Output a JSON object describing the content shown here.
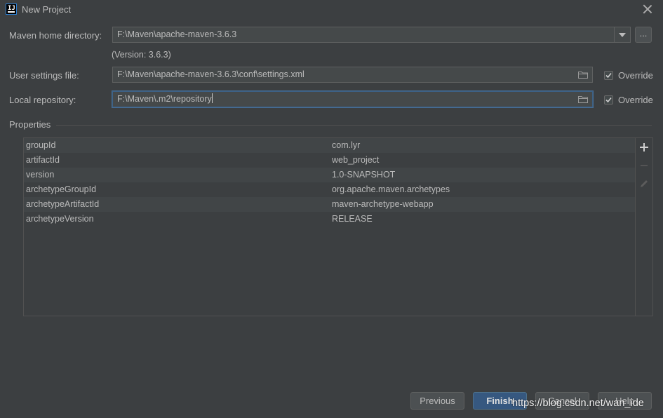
{
  "window": {
    "title": "New Project",
    "app_icon_text": "IJ"
  },
  "form": {
    "maven_home": {
      "label": "Maven home directory:",
      "value": "F:\\Maven\\apache-maven-3.6.3",
      "browse_label": "...",
      "version_text": "(Version: 3.6.3)"
    },
    "user_settings": {
      "label": "User settings file:",
      "value": "F:\\Maven\\apache-maven-3.6.3\\conf\\settings.xml",
      "override_label": "Override",
      "override_checked": true
    },
    "local_repository": {
      "label": "Local repository:",
      "value": "F:\\Maven\\.m2\\repository",
      "override_label": "Override",
      "override_checked": true
    }
  },
  "properties": {
    "title": "Properties",
    "rows": [
      {
        "key": "groupId",
        "value": "com.lyr"
      },
      {
        "key": "artifactId",
        "value": "web_project"
      },
      {
        "key": "version",
        "value": "1.0-SNAPSHOT"
      },
      {
        "key": "archetypeGroupId",
        "value": "org.apache.maven.archetypes"
      },
      {
        "key": "archetypeArtifactId",
        "value": "maven-archetype-webapp"
      },
      {
        "key": "archetypeVersion",
        "value": "RELEASE"
      }
    ],
    "toolbar": [
      "add-icon",
      "remove-icon",
      "edit-icon"
    ]
  },
  "buttons": {
    "previous": "Previous",
    "finish": "Finish",
    "cancel": "Cancel",
    "help": "Help"
  },
  "watermark": "https://blog.csdn.net/wan_ide",
  "colors": {
    "background": "#3c3f41",
    "field": "#45494a",
    "focus_border": "#3d6185",
    "primary_button": "#365880",
    "text": "#bbbbbb"
  }
}
